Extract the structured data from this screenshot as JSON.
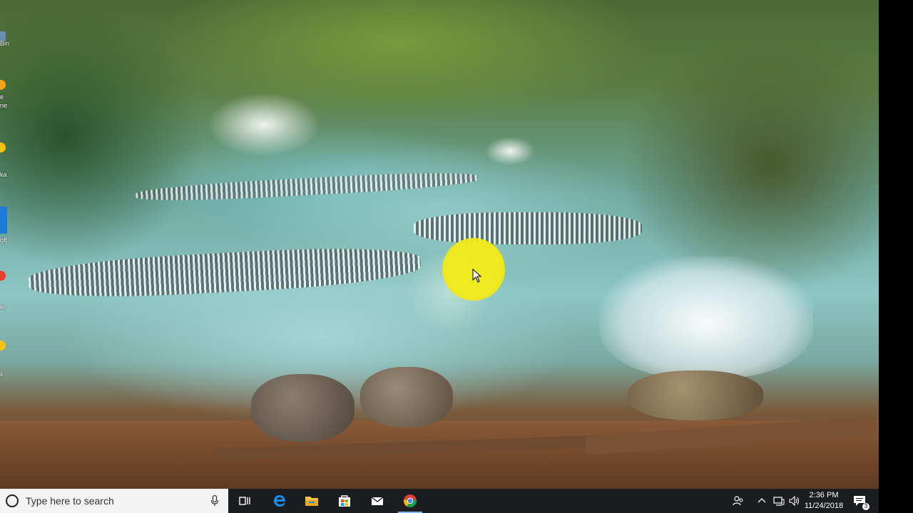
{
  "desktop": {
    "icons": [
      {
        "label": "Bin",
        "icon": "recycle-bin-icon",
        "color": "#6b8fb0"
      },
      {
        "label": "e\nne",
        "icon": "chrome-icon",
        "color": "#f2a418"
      },
      {
        "label": "ka",
        "icon": "app-icon",
        "color": "#f2c418"
      },
      {
        "label": "oft",
        "icon": "microsoft-edge-icon",
        "color": "#1e7ad6"
      },
      {
        "label": "er",
        "icon": "app-icon",
        "color": "#e84030"
      },
      {
        "label": "x",
        "icon": "app-icon",
        "color": "#f2c418"
      }
    ]
  },
  "cursor": {
    "highlight_color": "#f4ec1a"
  },
  "taskbar": {
    "search_placeholder": "Type here to search",
    "apps": [
      {
        "name": "task-view",
        "icon": "task-view-icon"
      },
      {
        "name": "edge",
        "icon": "edge-icon",
        "color": "#1e8be6"
      },
      {
        "name": "file-explorer",
        "icon": "folder-icon",
        "color": "#f6c342"
      },
      {
        "name": "store",
        "icon": "store-icon"
      },
      {
        "name": "mail",
        "icon": "mail-icon"
      },
      {
        "name": "chrome",
        "icon": "chrome-icon"
      }
    ],
    "tray": {
      "icons": [
        "people-icon",
        "chevron-up-icon",
        "network-icon",
        "volume-icon"
      ],
      "time": "2:36 PM",
      "date": "11/24/2018",
      "notification_count": "3"
    }
  }
}
